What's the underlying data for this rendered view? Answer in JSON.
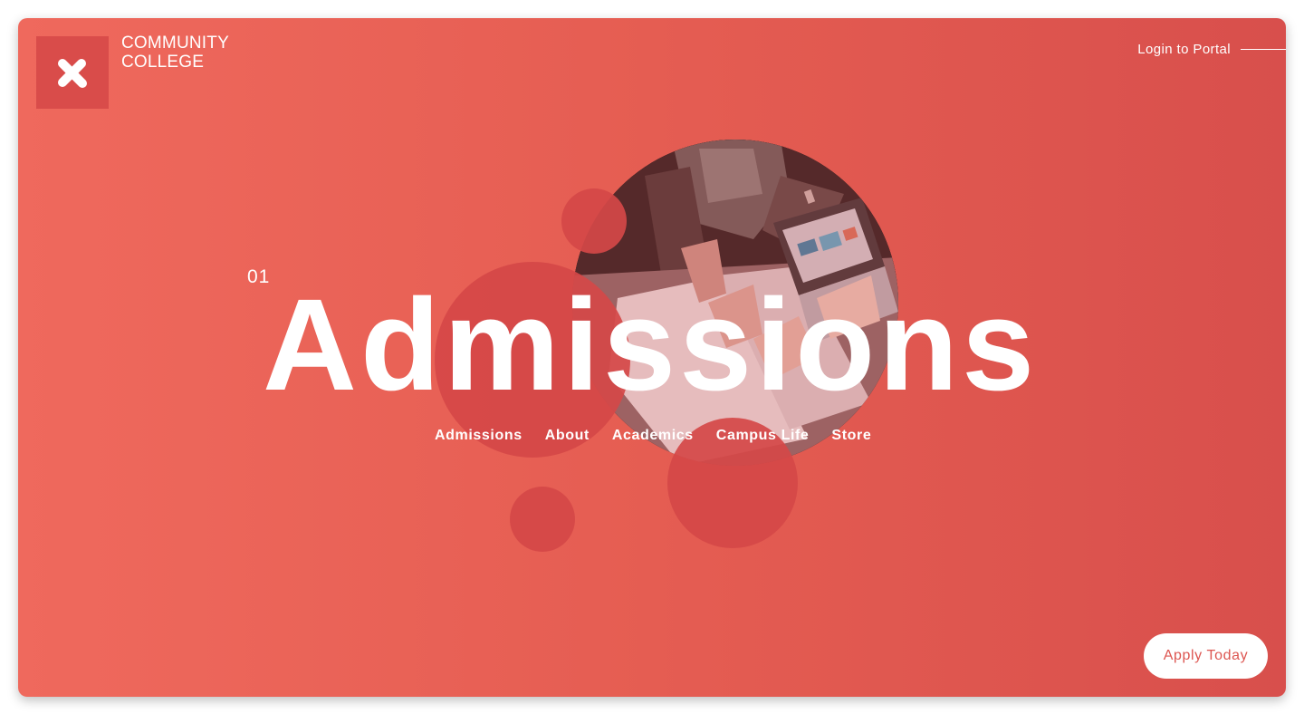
{
  "brand": {
    "name_line1": "COMMUNITY",
    "name_line2": "COLLEGE",
    "logo_icon": "x-logo-icon",
    "logo_box_color": "#d94c4a"
  },
  "header": {
    "portal_link": "Login to Portal"
  },
  "hero": {
    "slide_number": "01",
    "headline": "Admissions",
    "image_icon": "students-laptop-photo",
    "accent_color": "#e55d52",
    "bubble_color": "#d54848"
  },
  "nav": {
    "items": [
      {
        "label": "Admissions"
      },
      {
        "label": "About"
      },
      {
        "label": "Academics"
      },
      {
        "label": "Campus Life"
      },
      {
        "label": "Store"
      }
    ]
  },
  "cta": {
    "apply_label": "Apply Today",
    "text_color": "#dd5651"
  }
}
